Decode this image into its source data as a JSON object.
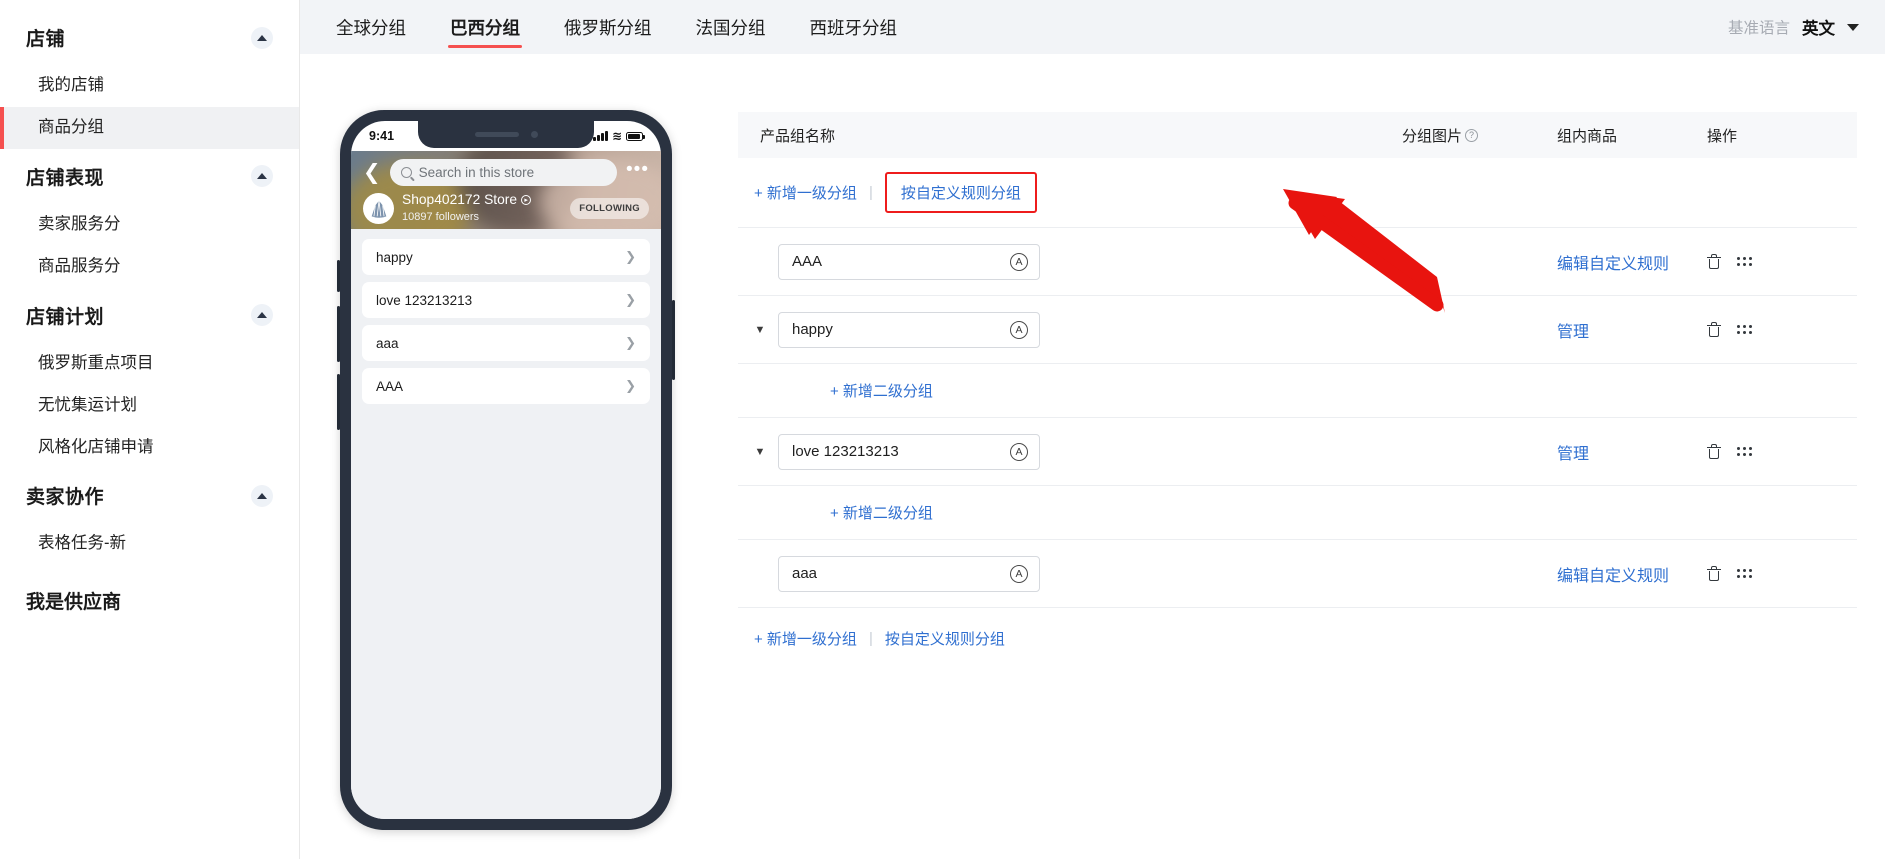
{
  "sidebar": {
    "groups": [
      {
        "title": "店铺",
        "caret": "caret-up-icon",
        "items": [
          {
            "label": "我的店铺",
            "active": false
          },
          {
            "label": "商品分组",
            "active": true
          }
        ]
      },
      {
        "title": "店铺表现",
        "caret": "caret-up-icon",
        "items": [
          {
            "label": "卖家服务分",
            "active": false
          },
          {
            "label": "商品服务分",
            "active": false
          }
        ]
      },
      {
        "title": "店铺计划",
        "caret": "caret-up-icon",
        "items": [
          {
            "label": "俄罗斯重点项目",
            "active": false
          },
          {
            "label": "无忧集运计划",
            "active": false
          },
          {
            "label": "风格化店铺申请",
            "active": false
          }
        ]
      },
      {
        "title": "卖家协作",
        "caret": "caret-up-icon",
        "items": [
          {
            "label": "表格任务-新",
            "active": false
          }
        ]
      }
    ],
    "standalone": "我是供应商"
  },
  "topbar": {
    "tabs": [
      {
        "label": "全球分组",
        "active": false
      },
      {
        "label": "巴西分组",
        "active": true
      },
      {
        "label": "俄罗斯分组",
        "active": false
      },
      {
        "label": "法国分组",
        "active": false
      },
      {
        "label": "西班牙分组",
        "active": false
      }
    ],
    "lang_label": "基准语言",
    "lang_value": "英文",
    "lang_arrow_icon": "chevron-down-icon"
  },
  "phone": {
    "status": {
      "time": "9:41",
      "signal_icon": "signal-bars-icon",
      "wifi_icon": "wifi-icon",
      "wifi_glyph": "≋",
      "battery_icon": "battery-icon"
    },
    "header": {
      "back_icon": "back-chevron-icon",
      "search_placeholder": "Search in this store",
      "search_icon": "search-icon",
      "more_icon": "more-dots-icon",
      "more_glyph": "•••",
      "store_name": "Shop402172 Store",
      "store_info_icon": "info-icon",
      "followers": "10897  followers",
      "follow_button": "FOLLOWING",
      "avatar_icon": "store-avatar-icon"
    },
    "categories": [
      {
        "label": "happy",
        "chevron": "chevron-right-icon"
      },
      {
        "label": "love 123213213",
        "chevron": "chevron-right-icon"
      },
      {
        "label": "aaa",
        "chevron": "chevron-right-icon"
      },
      {
        "label": "AAA",
        "chevron": "chevron-right-icon"
      }
    ]
  },
  "table": {
    "headers": {
      "name": "产品组名称",
      "image": "分组图片",
      "image_help_icon": "question-mark-icon",
      "goods": "组内商品",
      "ops": "操作"
    },
    "top_actions": {
      "add_level1": "+ 新增一级分组",
      "separator": "|",
      "custom_rule": "按自定义规则分组",
      "highlight_color": "#ee1c1c"
    },
    "rows": [
      {
        "expandable": false,
        "expand_icon": "",
        "name": "AAA",
        "translate_icon": "translate-badge-icon",
        "translate_glyph": "A",
        "action": "编辑自定义规则",
        "delete_icon": "trash-icon",
        "drag_icon": "drag-handle-icon",
        "sub_add": null
      },
      {
        "expandable": true,
        "expand_icon": "caret-down-icon",
        "name": "happy",
        "translate_icon": "translate-badge-icon",
        "translate_glyph": "A",
        "action": "管理",
        "delete_icon": "trash-icon",
        "drag_icon": "drag-handle-icon",
        "sub_add": "+ 新增二级分组"
      },
      {
        "expandable": true,
        "expand_icon": "caret-down-icon",
        "name": "love 123213213",
        "translate_icon": "translate-badge-icon",
        "translate_glyph": "A",
        "action": "管理",
        "delete_icon": "trash-icon",
        "drag_icon": "drag-handle-icon",
        "sub_add": "+ 新增二级分组"
      },
      {
        "expandable": false,
        "expand_icon": "",
        "name": "aaa",
        "translate_icon": "translate-badge-icon",
        "translate_glyph": "A",
        "action": "编辑自定义规则",
        "delete_icon": "trash-icon",
        "drag_icon": "drag-handle-icon",
        "sub_add": null
      }
    ],
    "bottom_actions": {
      "add_level1": "+ 新增一级分组",
      "separator": "|",
      "custom_rule": "按自定义规则分组"
    }
  },
  "annotation": {
    "arrow_icon": "red-pointer-arrow",
    "color": "#e8140f"
  }
}
